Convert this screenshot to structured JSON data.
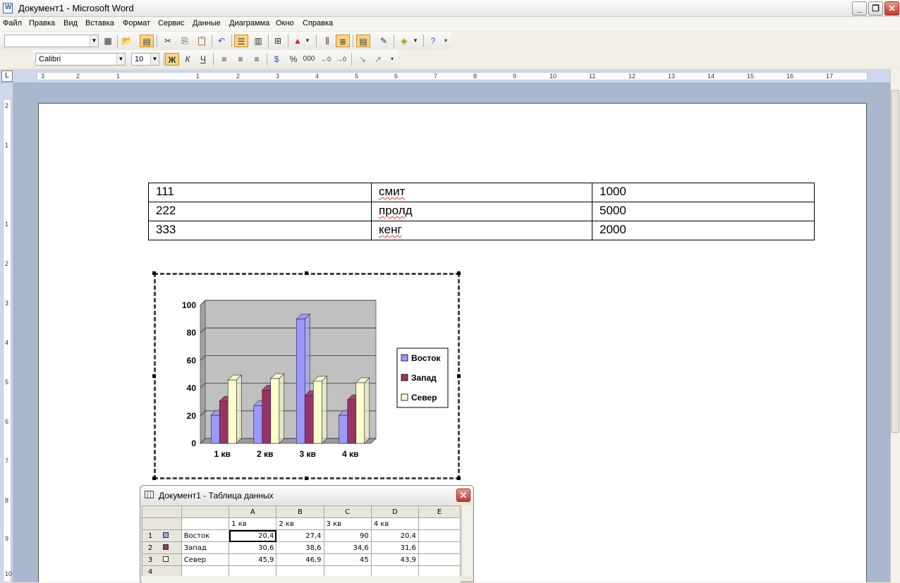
{
  "window": {
    "title": "Документ1 - Microsoft Word"
  },
  "menu": [
    "Файл",
    "Правка",
    "Вид",
    "Вставка",
    "Формат",
    "Сервис",
    "Данные",
    "Диаграмма",
    "Окно",
    "Справка"
  ],
  "format_toolbar": {
    "font": "Calibri",
    "size": "10",
    "bold_label": "Ж",
    "italic_label": "К",
    "underline_label": "Ч",
    "percent_label": "%",
    "thousands_label": "000"
  },
  "ruler": {
    "h_numbers": [
      "3",
      "2",
      "1",
      "1",
      "2",
      "3",
      "4",
      "5",
      "6",
      "7",
      "8",
      "9",
      "10",
      "11",
      "12",
      "13",
      "14",
      "15",
      "16",
      "17"
    ],
    "v_numbers": [
      "2",
      "1",
      "1",
      "2",
      "3",
      "4",
      "5",
      "6",
      "7",
      "8",
      "9",
      "10"
    ]
  },
  "doc_table": [
    [
      "111",
      "смит",
      "1000"
    ],
    [
      "222",
      "пролд",
      "5000"
    ],
    [
      "333",
      "кенг",
      "2000"
    ]
  ],
  "chart_data": {
    "type": "bar",
    "categories": [
      "1 кв",
      "2 кв",
      "3 кв",
      "4 кв"
    ],
    "series": [
      {
        "name": "Восток",
        "values": [
          20.4,
          27.4,
          90,
          20.4
        ],
        "color": "#9999ff"
      },
      {
        "name": "Запад",
        "values": [
          30.6,
          38.6,
          34.6,
          31.6
        ],
        "color": "#993366"
      },
      {
        "name": "Север",
        "values": [
          45.9,
          46.9,
          45,
          43.9
        ],
        "color": "#ffffcc"
      }
    ],
    "ylim": [
      0,
      100
    ],
    "yticks": [
      "0",
      "20",
      "40",
      "60",
      "80",
      "100"
    ],
    "grid": true,
    "legend": "right",
    "plot_background": "#c0c0c0"
  },
  "datasheet": {
    "title": "Документ1 - Таблица данных",
    "columns": [
      "A",
      "B",
      "C",
      "D",
      "E"
    ],
    "categories": [
      "1 кв",
      "2 кв",
      "3 кв",
      "4 кв"
    ],
    "rows": [
      {
        "num": "1",
        "name": "Восток",
        "values": [
          "20,4",
          "27,4",
          "90",
          "20,4"
        ]
      },
      {
        "num": "2",
        "name": "Запад",
        "values": [
          "30,6",
          "38,6",
          "34,6",
          "31,6"
        ]
      },
      {
        "num": "3",
        "name": "Север",
        "values": [
          "45,9",
          "46,9",
          "45",
          "43,9"
        ]
      }
    ],
    "extra_row": "4"
  }
}
